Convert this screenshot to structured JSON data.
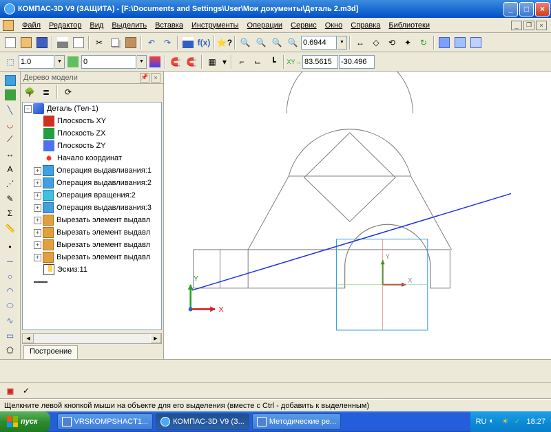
{
  "titlebar": {
    "title": "КОМПАС-3D V9 (ЗАЩИТА) - [F:\\Documents and Settings\\User\\Мои документы\\Деталь 2.m3d]"
  },
  "menu": {
    "items": [
      "Файл",
      "Редактор",
      "Вид",
      "Выделить",
      "Вставка",
      "Инструменты",
      "Операции",
      "Сервис",
      "Окно",
      "Справка",
      "Библиотеки"
    ]
  },
  "toolbar2": {
    "val1": "1.0",
    "val2": "0"
  },
  "toolbar1": {
    "zoom_val": "0.6944"
  },
  "coords": {
    "x": "83.5615",
    "y": "-30.496"
  },
  "panel": {
    "title": "Дерево модели",
    "root": "Деталь (Тел-1)",
    "planes": [
      "Плоскость XY",
      "Плоскость ZX",
      "Плоскость ZY"
    ],
    "origin": "Начало координат",
    "ops": [
      {
        "ic": "ic-extr",
        "label": "Операция выдавливания:1"
      },
      {
        "ic": "ic-extr",
        "label": "Операция выдавливания:2"
      },
      {
        "ic": "ic-rev",
        "label": "Операция вращения:2"
      },
      {
        "ic": "ic-extr",
        "label": "Операция выдавливания:3"
      },
      {
        "ic": "ic-cut",
        "label": "Вырезать элемент выдавл"
      },
      {
        "ic": "ic-cut",
        "label": "Вырезать элемент выдавл"
      },
      {
        "ic": "ic-cut",
        "label": "Вырезать элемент выдавл"
      },
      {
        "ic": "ic-cut",
        "label": "Вырезать элемент выдавл"
      }
    ],
    "sketch": "Эскиз:11",
    "tab": "Построение"
  },
  "canvas": {
    "axis_x": "X",
    "axis_y": "Y",
    "origin_x": "X",
    "origin_y": "Y"
  },
  "status": "Щелкните левой кнопкой мыши на объекте для его выделения (вместе с Ctrl - добавить к выделенным)",
  "taskbar": {
    "start": "пуск",
    "items": [
      "VRSKOMPSHACT1...",
      "КОМПАС-3D V9 (З...",
      "Методические ре..."
    ],
    "lang": "RU",
    "clock": "18:27"
  }
}
